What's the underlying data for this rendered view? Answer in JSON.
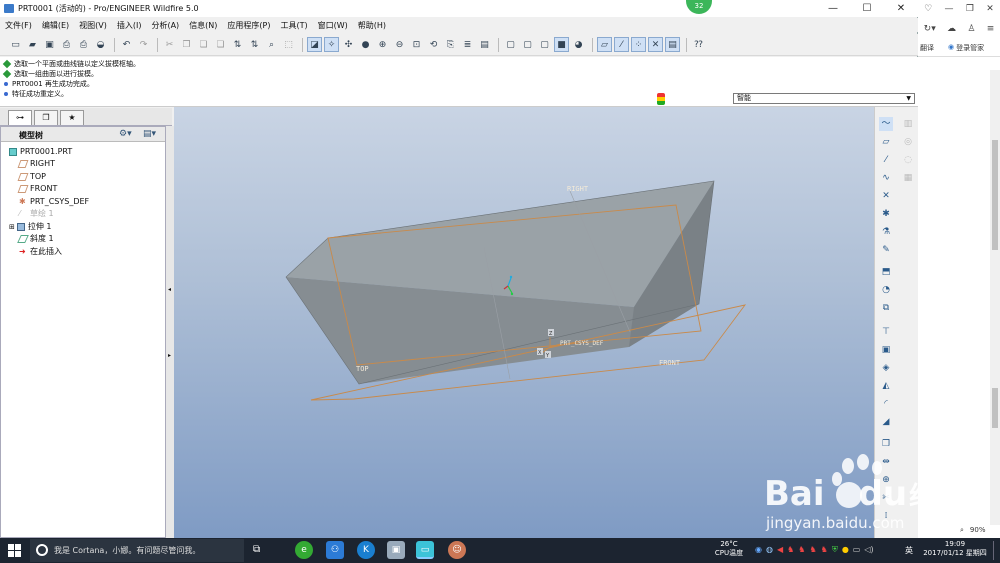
{
  "window": {
    "title": "PRT0001 (活动的) - Pro/ENGINEER Wildfire 5.0",
    "badge": "32"
  },
  "window_controls": {
    "minimize": "—",
    "maximize": "☐",
    "close": "✕"
  },
  "menu": [
    "文件(F)",
    "编辑(E)",
    "视图(V)",
    "插入(I)",
    "分析(A)",
    "信息(N)",
    "应用程序(P)",
    "工具(T)",
    "窗口(W)",
    "帮助(H)"
  ],
  "messages": [
    "选取一个平面或曲线链以定义拔模枢轴。",
    "选取一组曲面以进行拔模。",
    "PRT0001 再生成功完成。",
    "特征成功重定义。"
  ],
  "selection_filter": "智能",
  "tree": {
    "header": "模型树",
    "items": [
      "PRT0001.PRT",
      "RIGHT",
      "TOP",
      "FRONT",
      "PRT_CSYS_DEF",
      "草绘 1",
      "拉伸 1",
      "斜度 1",
      "在此插入"
    ]
  },
  "viewport_labels": {
    "right": "RIGHT",
    "top": "TOP",
    "front": "FRONT",
    "csys": "PRT_CSYS_DEF",
    "csys_x": "X",
    "csys_y": "Y",
    "csys_z": "Z"
  },
  "browser": {
    "translate": "翻译",
    "login": "登录管家",
    "zoom": "90%"
  },
  "taskbar": {
    "cortana": "我是 Cortana，小娜。有问题尽管问我。",
    "weather_temp": "26°C",
    "weather_label": "CPU温度",
    "ime": "英",
    "time": "19:09",
    "date": "2017/01/12 星期四"
  },
  "watermark": {
    "brand": "Bai",
    "brand2": "du",
    "cn": "经验",
    "url": "jingyan.baidu.com"
  },
  "colors": {
    "viewport_top": "#c9d4e4",
    "viewport_bottom": "#7f9bc4",
    "model_face": "#8a9196",
    "datum_orange": "#c98a4a",
    "taskbar": "#1c2430"
  }
}
